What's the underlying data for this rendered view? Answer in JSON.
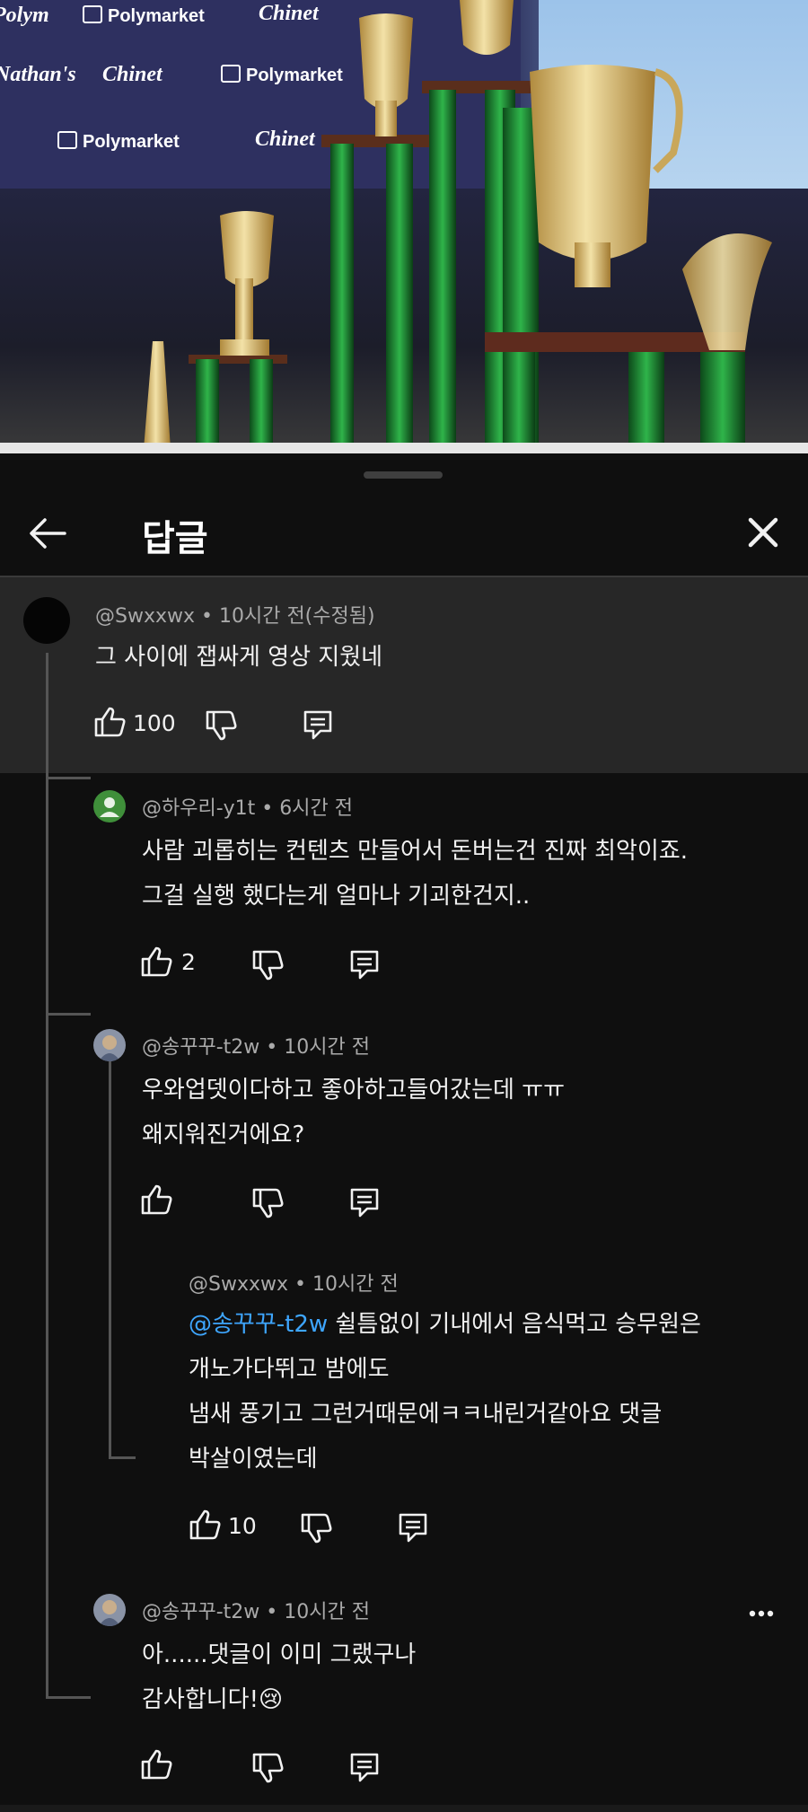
{
  "video": {
    "sponsors": [
      "Polymarket",
      "Chinet",
      "Polymarket",
      "Chinet",
      "Polymarket",
      "Chinet",
      "Nathan's",
      "Polym"
    ]
  },
  "header": {
    "title": "답글"
  },
  "comments": [
    {
      "author": "@Swxxwx",
      "meta": " • 10시간 전(수정됨)",
      "lines": [
        "그 사이에 잽싸게 영상 지웠네"
      ],
      "likes": "100"
    },
    {
      "author": "@하우리-y1t",
      "meta": " • 6시간 전",
      "lines": [
        "사람 괴롭히는 컨텐츠 만들어서 돈버는건 진짜 최악이죠.",
        "그걸 실행 했다는게 얼마나 기괴한건지.."
      ],
      "likes": "2"
    },
    {
      "author": "@송꾸꾸-t2w",
      "meta": " • 10시간 전",
      "lines": [
        "우와업뎃이다하고 좋아하고들어갔는데 ㅠㅠ",
        "왜지워진거에요?"
      ],
      "likes": ""
    },
    {
      "author": "@Swxxwx",
      "meta": " • 10시간 전",
      "mention": "@송꾸꾸-t2w",
      "lines": [
        " 쉴틈없이 기내에서 음식먹고 승무원은",
        "개노가다뛰고 밤에도",
        "냄새 풍기고 그런거때문에ㅋㅋ내린거같아요 댓글",
        "박살이였는데"
      ],
      "likes": "10"
    },
    {
      "author": "@송꾸꾸-t2w",
      "meta": " • 10시간 전",
      "lines": [
        "아......댓글이 이미 그랬구나",
        "감사합니다!😢"
      ],
      "likes": ""
    }
  ],
  "icons": {
    "back": "arrow-left",
    "close": "x",
    "like": "thumbs-up",
    "dislike": "thumbs-down",
    "reply": "comment-bubble",
    "more": "vertical-ellipsis"
  },
  "colors": {
    "background": "#0f0f0f",
    "highlight": "#272727",
    "mention": "#3ea6ff",
    "meta": "#aaaaaa"
  }
}
